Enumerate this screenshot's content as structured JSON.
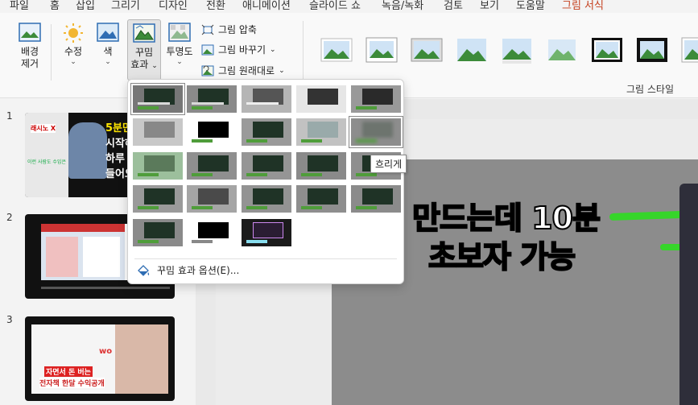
{
  "menu": {
    "tabs": [
      "파일",
      "홈",
      "삽입",
      "그리기",
      "디자인",
      "전환",
      "애니메이션",
      "슬라이드 쇼",
      "녹음/녹화",
      "검토",
      "보기",
      "도움말",
      "그림 서식"
    ],
    "active_tab": "그림 서식"
  },
  "ribbon": {
    "remove_bg": {
      "line1": "배경",
      "line2": "제거"
    },
    "corrections": {
      "line1": "수정",
      "chevron": "⌄"
    },
    "color": {
      "line1": "색",
      "chevron": "⌄"
    },
    "artistic": {
      "line1": "꾸밈",
      "line2": "효과",
      "chevron": "⌄"
    },
    "transparency": {
      "line1": "투명도",
      "chevron": "⌄"
    },
    "compress": "그림 압축",
    "change": "그림 바꾸기",
    "reset": "그림 원래대로",
    "picture_styles_label": "그림 스타일"
  },
  "slides": [
    {
      "number": "1",
      "text_lines": [
        "5분만",
        "시작하",
        "하루 9",
        "들어오"
      ],
      "badge": "래시노 X",
      "caption": "이런 사람도 수입은"
    },
    {
      "number": "2"
    },
    {
      "number": "3",
      "text_lines": [
        "자면서 돈 버는",
        "전자책 한달 수익공개"
      ],
      "badge": "wo"
    }
  ],
  "slide_main": {
    "line1": "만드는데 10분",
    "line2_green": "초보자",
    "line2_rest": " 가능"
  },
  "dropdown": {
    "option_label": "꾸밈 효과 옵션(E)...",
    "tooltip": "흐리게"
  },
  "colors": {
    "accent": "#c43e1c",
    "green": "#36d52a"
  }
}
